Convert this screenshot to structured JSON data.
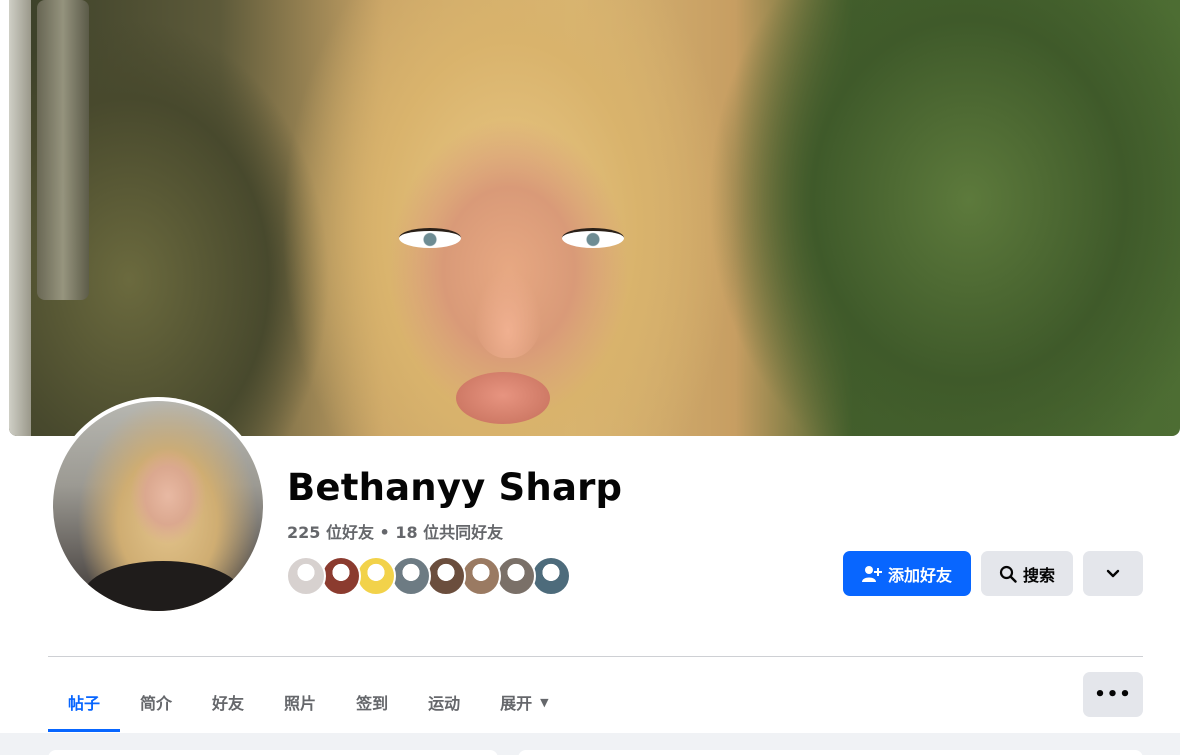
{
  "profile": {
    "name": "Bethanyy Sharp",
    "stats": "225 位好友 • 18 位共同好友"
  },
  "mutual_friend_avatars": [
    {
      "color": "#d7d1cf"
    },
    {
      "color": "#8b3b2f"
    },
    {
      "color": "#f2d24a"
    },
    {
      "color": "#6d7b83"
    },
    {
      "color": "#6b4e3d"
    },
    {
      "color": "#9a7a62"
    },
    {
      "color": "#7a7068"
    },
    {
      "color": "#4d6b7b"
    }
  ],
  "actions": {
    "add_friend_label": "添加好友",
    "search_label": "搜索"
  },
  "tabs": [
    {
      "label": "帖子",
      "active": true
    },
    {
      "label": "简介",
      "active": false
    },
    {
      "label": "好友",
      "active": false
    },
    {
      "label": "照片",
      "active": false
    },
    {
      "label": "签到",
      "active": false
    },
    {
      "label": "运动",
      "active": false
    },
    {
      "label": "展开",
      "active": false
    }
  ],
  "icons": {
    "add_friend": "add-person-icon",
    "search": "search-icon",
    "more": "chevron-down-icon",
    "tab_more": "caret-down-icon",
    "ellipsis": "ellipsis-icon"
  },
  "colors": {
    "primary": "#0866ff",
    "secondary_button": "#e4e6eb",
    "muted_text": "#65676b"
  }
}
